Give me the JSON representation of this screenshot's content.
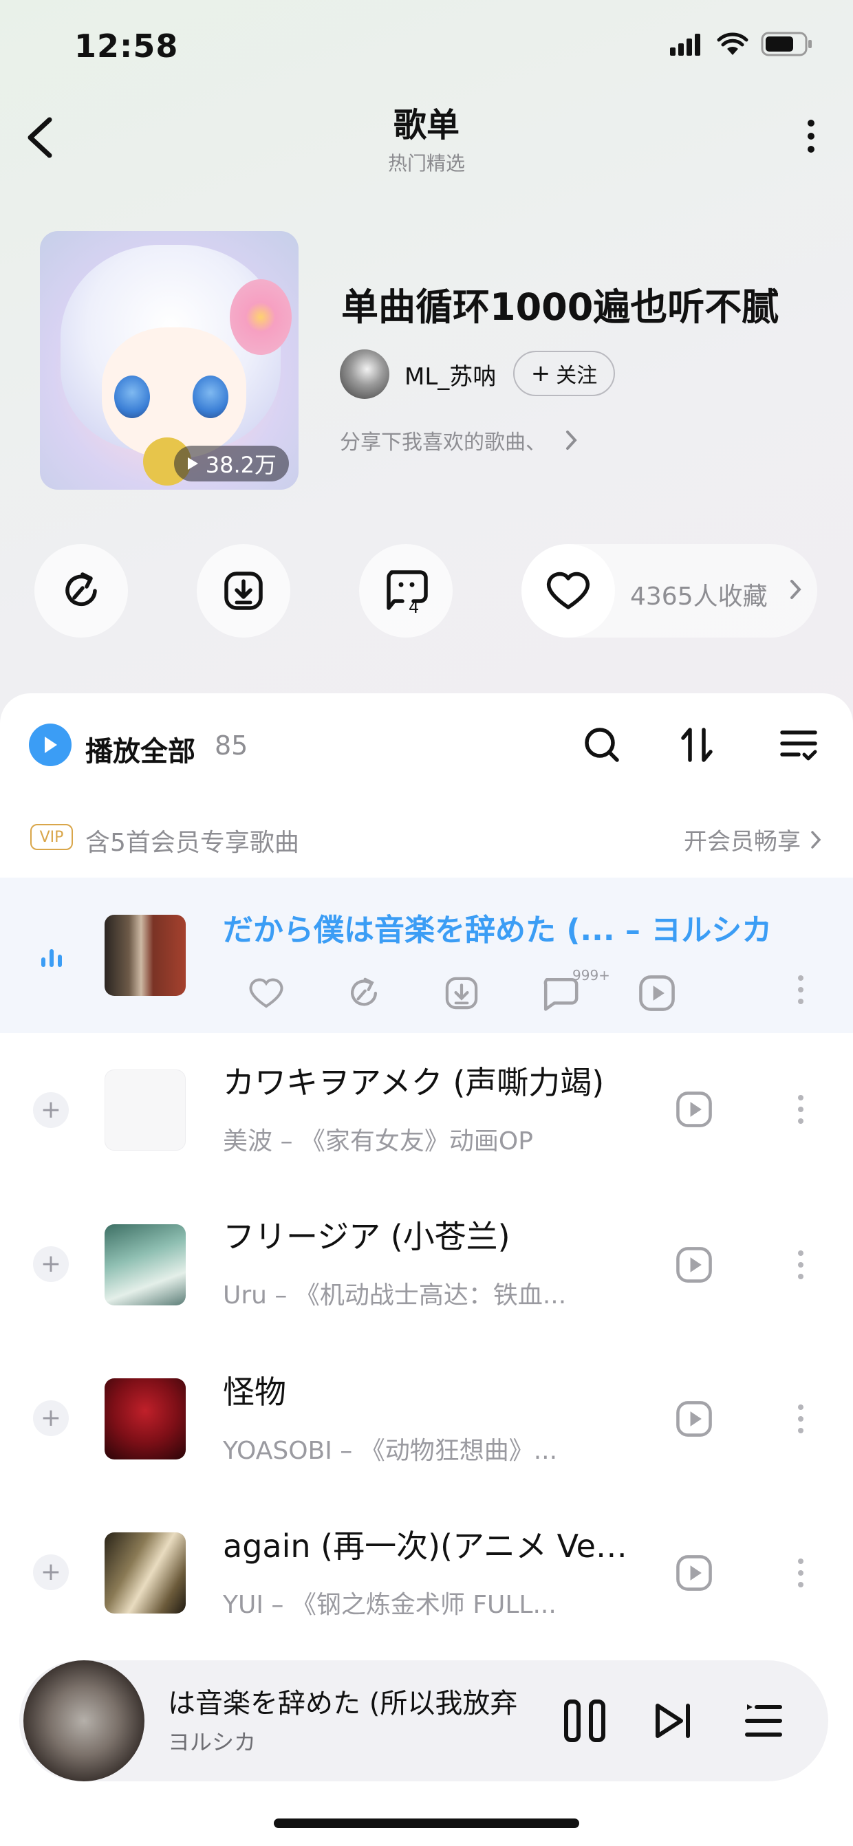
{
  "status_bar": {
    "time": "12:58"
  },
  "header": {
    "title": "歌单",
    "subtitle": "热门精选"
  },
  "playlist": {
    "play_count": "38.2万",
    "title": "单曲循环1000遍也听不腻",
    "creator": "ML_苏呐",
    "follow_label": "关注",
    "description": "分享下我喜欢的歌曲、"
  },
  "actions": {
    "comment_count": "4",
    "collect_text": "4365人收藏"
  },
  "list_header": {
    "play_all": "播放全部",
    "count": "85"
  },
  "vip": {
    "badge": "VIP",
    "text": "含5首会员专享歌曲",
    "link": "开会员畅享"
  },
  "current_song": {
    "title": "だから僕は音楽を辞めた (... – ヨルシカ",
    "comment_badge": "999+"
  },
  "songs": [
    {
      "title": "カワキヲアメク (声嘶力竭)",
      "subtitle": "美波 – 《家有女友》动画OP"
    },
    {
      "title": "フリージア (小苍兰)",
      "subtitle": "Uru – 《机动战士高达：铁血..."
    },
    {
      "title": "怪物",
      "subtitle": "YOASOBI – 《动物狂想曲》..."
    },
    {
      "title": "again (再一次)(アニメ Ver...",
      "subtitle": "YUI – 《钢之炼金术师 FULL..."
    }
  ],
  "mini_player": {
    "title": "は音楽を辞めた (所以我放弃",
    "artist": "ヨルシカ"
  },
  "colors": {
    "accent": "#3b9df5",
    "vip": "#d9a64a",
    "muted": "#8e8e93"
  }
}
